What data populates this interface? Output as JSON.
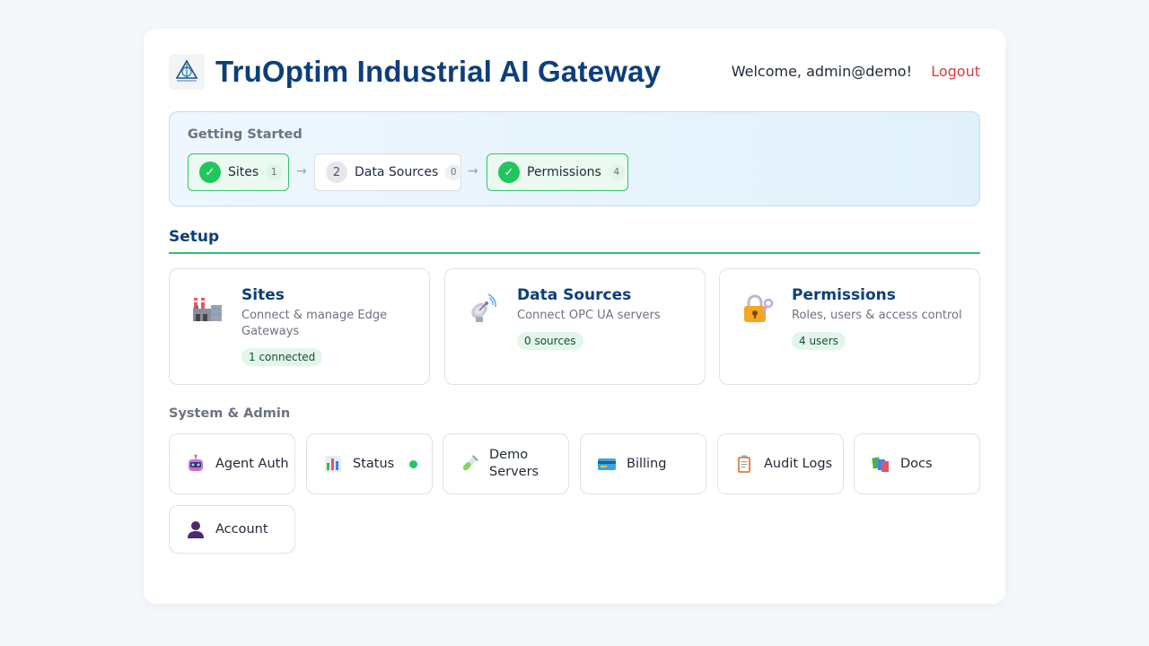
{
  "header": {
    "title": "TruOptim Industrial AI Gateway",
    "welcome": "Welcome, admin@demo!",
    "logout": "Logout",
    "logo_icon": "truoptim-logo-icon"
  },
  "getting_started": {
    "title": "Getting Started",
    "steps": [
      {
        "label": "Sites",
        "count": "1",
        "state": "done",
        "marker": "✓"
      },
      {
        "label": "Data Sources",
        "count": "0",
        "state": "todo",
        "marker": "2"
      },
      {
        "label": "Permissions",
        "count": "4",
        "state": "done",
        "marker": "✓"
      }
    ],
    "arrow": "→"
  },
  "setup": {
    "title": "Setup",
    "cards": [
      {
        "title": "Sites",
        "description": "Connect & manage Edge Gateways",
        "badge": "1 connected",
        "icon": "factory-icon"
      },
      {
        "title": "Data Sources",
        "description": "Connect OPC UA servers",
        "badge": "0 sources",
        "icon": "satellite-dish-icon"
      },
      {
        "title": "Permissions",
        "description": "Roles, users & access control",
        "badge": "4 users",
        "icon": "lock-key-icon"
      }
    ]
  },
  "system": {
    "title": "System & Admin",
    "tiles": [
      {
        "label": "Agent Auth",
        "icon": "robot-icon"
      },
      {
        "label": "Status",
        "icon": "bar-chart-icon",
        "status_color": "#22c55e"
      },
      {
        "label": "Demo Servers",
        "icon": "test-tube-icon"
      },
      {
        "label": "Billing",
        "icon": "credit-card-icon"
      },
      {
        "label": "Audit Logs",
        "icon": "clipboard-icon"
      },
      {
        "label": "Docs",
        "icon": "books-icon"
      },
      {
        "label": "Account",
        "icon": "user-icon"
      }
    ]
  },
  "colors": {
    "brand": "#0c3e7a",
    "accent_green": "#22c55e",
    "logout_red": "#dc3b3b"
  }
}
